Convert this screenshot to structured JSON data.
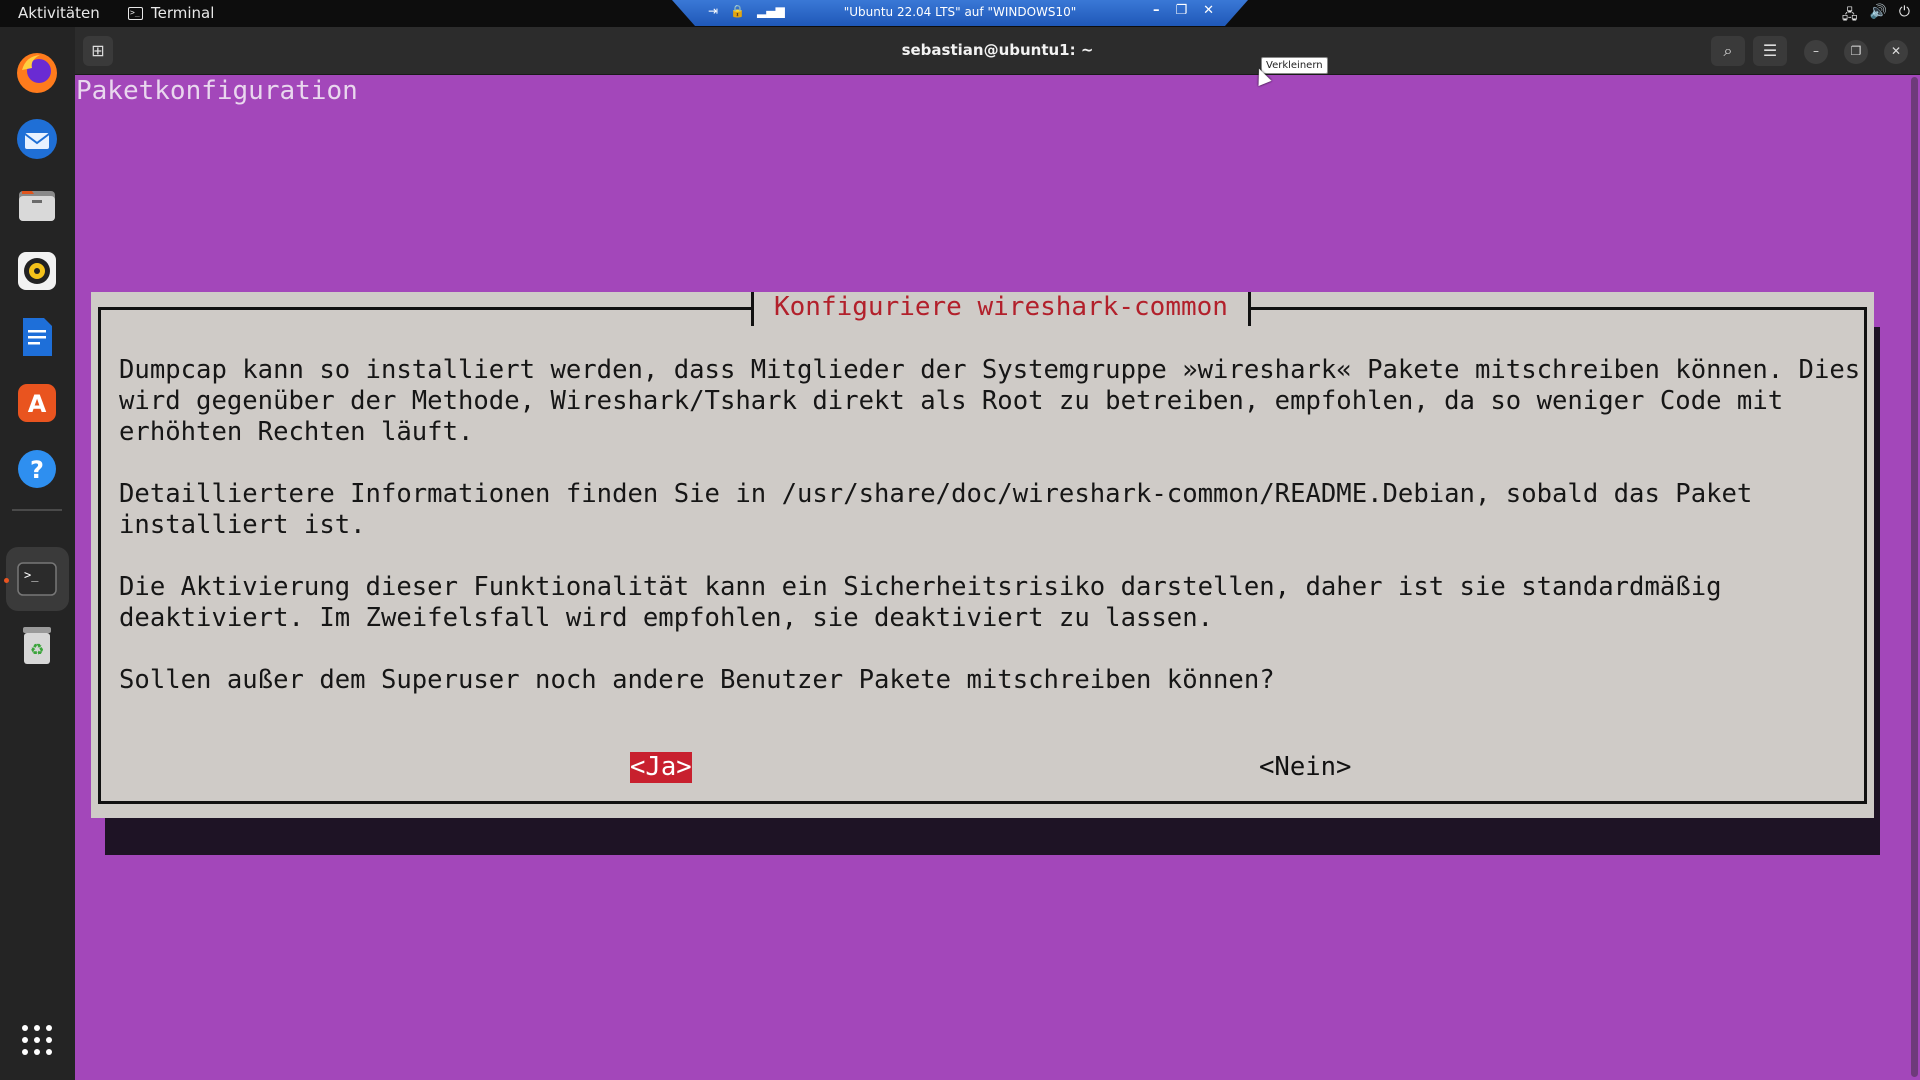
{
  "topbar": {
    "activities": "Aktivitäten",
    "app_name": "Terminal"
  },
  "vmbar": {
    "title": "\"Ubuntu 22.04 LTS\" auf \"WINDOWS10\""
  },
  "window": {
    "title": "sebastian@ubuntu1: ~",
    "tooltip": "Verkleinern"
  },
  "terminal": {
    "backtitle": "Paketkonfiguration",
    "dialog_title": "Konfiguriere wireshark-common",
    "paragraph1": "Dumpcap kann so installiert werden, dass Mitglieder der Systemgruppe »wireshark« Pakete mitschreiben können. Dies\nwird gegenüber der Methode, Wireshark/Tshark direkt als Root zu betreiben, empfohlen, da so weniger Code mit\nerhöhten Rechten läuft.",
    "paragraph2": "Detailliertere Informationen finden Sie in /usr/share/doc/wireshark-common/README.Debian, sobald das Paket\ninstalliert ist.",
    "paragraph3": "Die Aktivierung dieser Funktionalität kann ein Sicherheitsrisiko darstellen, daher ist sie standardmäßig\ndeaktiviert. Im Zweifelsfall wird empfohlen, sie deaktiviert zu lassen.",
    "question": "Sollen außer dem Superuser noch andere Benutzer Pakete mitschreiben können?",
    "yes_button": "<Ja>",
    "no_button": "<Nein>"
  },
  "colors": {
    "terminal_bg": "#a347ba",
    "dialog_bg": "#cfcbc7",
    "dialog_title": "#b2202b",
    "selected_button": "#c8202e"
  },
  "dock_icons": [
    "firefox-icon",
    "thunderbird-icon",
    "files-icon",
    "rhythmbox-icon",
    "writer-icon",
    "app-center-icon",
    "help-icon",
    "terminal-icon",
    "trash-icon",
    "app-grid-icon"
  ]
}
